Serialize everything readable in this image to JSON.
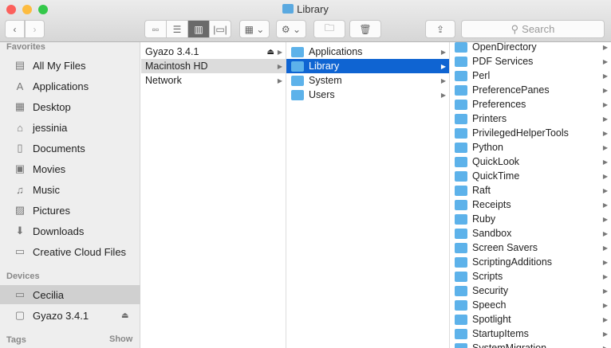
{
  "window": {
    "title": "Library"
  },
  "toolbar": {
    "search_placeholder": "Search"
  },
  "sidebar": {
    "favorites_header": "Favorites",
    "favorites": [
      {
        "label": "All My Files",
        "icon": "all-files-icon"
      },
      {
        "label": "Applications",
        "icon": "applications-icon"
      },
      {
        "label": "Desktop",
        "icon": "desktop-icon"
      },
      {
        "label": "jessinia",
        "icon": "home-icon"
      },
      {
        "label": "Documents",
        "icon": "documents-icon"
      },
      {
        "label": "Movies",
        "icon": "movies-icon"
      },
      {
        "label": "Music",
        "icon": "music-icon"
      },
      {
        "label": "Pictures",
        "icon": "pictures-icon"
      },
      {
        "label": "Downloads",
        "icon": "downloads-icon"
      },
      {
        "label": "Creative Cloud Files",
        "icon": "folder-icon"
      }
    ],
    "devices_header": "Devices",
    "devices": [
      {
        "label": "Cecilia"
      },
      {
        "label": "Gyazo 3.4.1"
      }
    ],
    "tags_header": "Tags",
    "tags_show": "Show"
  },
  "columns": {
    "col1": [
      "Gyazo 3.4.1",
      "Macintosh HD",
      "Network"
    ],
    "col2": [
      "Applications",
      "Library",
      "System",
      "Users"
    ],
    "col3": [
      "OpenDirectory",
      "PDF Services",
      "Perl",
      "PreferencePanes",
      "Preferences",
      "Printers",
      "PrivilegedHelperTools",
      "Python",
      "QuickLook",
      "QuickTime",
      "Raft",
      "Receipts",
      "Ruby",
      "Sandbox",
      "Screen Savers",
      "ScriptingAdditions",
      "Scripts",
      "Security",
      "Speech",
      "Spotlight",
      "StartupItems",
      "SystemMigration"
    ]
  },
  "colors": {
    "selection": "#0f64d2",
    "folder": "#5db2ea"
  }
}
